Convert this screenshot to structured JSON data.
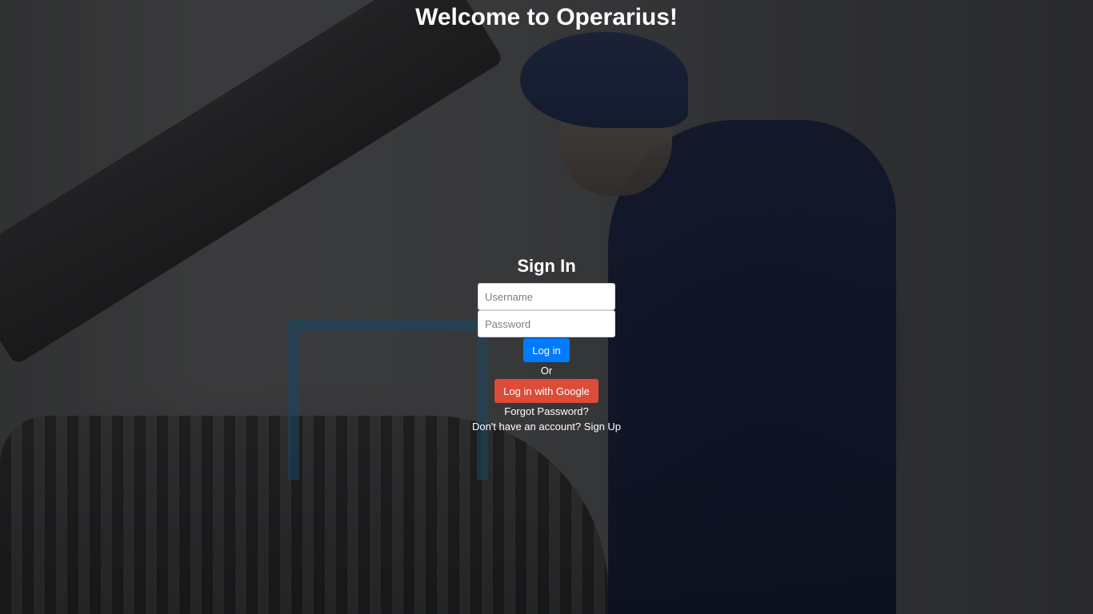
{
  "page": {
    "title": "Welcome to Operarius!"
  },
  "signin": {
    "heading": "Sign In",
    "username_placeholder": "Username",
    "password_placeholder": "Password",
    "login_label": "Log in",
    "or_label": "Or",
    "google_label": "Log in with Google",
    "forgot_label": "Forgot Password?",
    "no_account_label": "Don't have an account?",
    "signup_label": "Sign Up"
  },
  "colors": {
    "primary": "#007bff",
    "google": "#dd4b39",
    "text": "#ffffff"
  }
}
